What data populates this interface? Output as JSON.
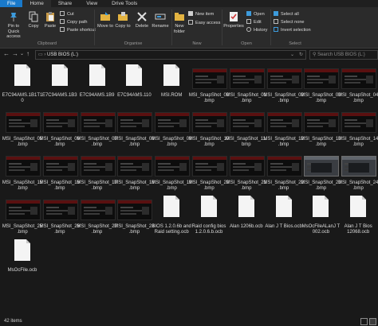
{
  "tabs": [
    "File",
    "Home",
    "Share",
    "View",
    "Drive Tools"
  ],
  "ribbon": {
    "clipboard": {
      "pin": "Pin to Quick access",
      "copy": "Copy",
      "paste": "Paste",
      "cut": "Cut",
      "copy_path": "Copy path",
      "paste_shortcut": "Paste shortcut",
      "label": "Clipboard"
    },
    "organise": {
      "move_to": "Move to",
      "copy_to": "Copy to",
      "delete": "Delete",
      "rename": "Rename",
      "label": "Organise"
    },
    "new": {
      "new_folder": "New folder",
      "new_item": "New item",
      "easy_access": "Easy access",
      "label": "New"
    },
    "open": {
      "properties": "Properties",
      "open": "Open",
      "edit": "Edit",
      "history": "History",
      "label": "Open"
    },
    "select": {
      "select_all": "Select all",
      "select_none": "Select none",
      "invert": "Invert selection",
      "label": "Select"
    }
  },
  "address": {
    "path": "USB BIOS (L:)",
    "search_placeholder": "Search USB BIOS (L:)"
  },
  "files": [
    {
      "name": "E7C94AMS.1B1T10",
      "kind": "doc"
    },
    {
      "name": "E7C94AMS.1B3",
      "kind": "doc"
    },
    {
      "name": "E7C94AMS.1B9",
      "kind": "doc"
    },
    {
      "name": "E7C94AMS.110",
      "kind": "doc"
    },
    {
      "name": "MSI.ROM",
      "kind": "doc"
    },
    {
      "name": "MSI_SnapShot_00.bmp",
      "kind": "img"
    },
    {
      "name": "MSI_SnapShot_01.bmp",
      "kind": "img"
    },
    {
      "name": "MSI_SnapShot_02.bmp",
      "kind": "img"
    },
    {
      "name": "MSI_SnapShot_03.bmp",
      "kind": "img"
    },
    {
      "name": "MSI_SnapShot_04.bmp",
      "kind": "img"
    },
    {
      "name": "MSI_SnapShot_05.bmp",
      "kind": "img"
    },
    {
      "name": "MSI_SnapShot_06.bmp",
      "kind": "img"
    },
    {
      "name": "MSI_SnapShot_07.bmp",
      "kind": "img"
    },
    {
      "name": "MSI_SnapShot_08.bmp",
      "kind": "img"
    },
    {
      "name": "MSI_SnapShot_09.bmp",
      "kind": "img"
    },
    {
      "name": "MSI_SnapShot_10.bmp",
      "kind": "img"
    },
    {
      "name": "MSI_SnapShot_11.bmp",
      "kind": "img"
    },
    {
      "name": "MSI_SnapShot_12.bmp",
      "kind": "img"
    },
    {
      "name": "MSI_SnapShot_13.bmp",
      "kind": "img"
    },
    {
      "name": "MSI_SnapShot_14.bmp",
      "kind": "img"
    },
    {
      "name": "MSI_SnapShot_15.bmp",
      "kind": "img"
    },
    {
      "name": "MSI_SnapShot_16.bmp",
      "kind": "img"
    },
    {
      "name": "MSI_SnapShot_17.bmp",
      "kind": "img"
    },
    {
      "name": "MSI_SnapShot_18.bmp",
      "kind": "img"
    },
    {
      "name": "MSI_SnapShot_19.bmp",
      "kind": "img"
    },
    {
      "name": "MSI_SnapShot_20.bmp",
      "kind": "img"
    },
    {
      "name": "MSI_SnapShot_21.bmp",
      "kind": "img"
    },
    {
      "name": "MSI_SnapShot_22.bmp",
      "kind": "img"
    },
    {
      "name": "MSI_SnapShot_23.bmp",
      "kind": "img-grey"
    },
    {
      "name": "MSI_SnapShot_24.bmp",
      "kind": "img-grey"
    },
    {
      "name": "MSI_SnapShot_25.bmp",
      "kind": "img"
    },
    {
      "name": "MSI_SnapShot_26.bmp",
      "kind": "img"
    },
    {
      "name": "MSI_SnapShot_27.bmp",
      "kind": "img"
    },
    {
      "name": "MSI_SnapShot_28.bmp",
      "kind": "img"
    },
    {
      "name": "BIOS 1.2.0.6b and Raid setting.ocb",
      "kind": "doc"
    },
    {
      "name": "Raid config bios 1.2.0.6.b.ocb",
      "kind": "doc"
    },
    {
      "name": "Alan 1206b.ocb",
      "kind": "doc"
    },
    {
      "name": "Alan J T Bios.ocb",
      "kind": "doc"
    },
    {
      "name": "MsOcFileALanJ T 002.ocb",
      "kind": "doc"
    },
    {
      "name": "Alan J T Bios 12068.ocb",
      "kind": "doc"
    },
    {
      "name": "MsOcFile.ocb",
      "kind": "doc"
    }
  ],
  "status": {
    "count": "42 items"
  }
}
